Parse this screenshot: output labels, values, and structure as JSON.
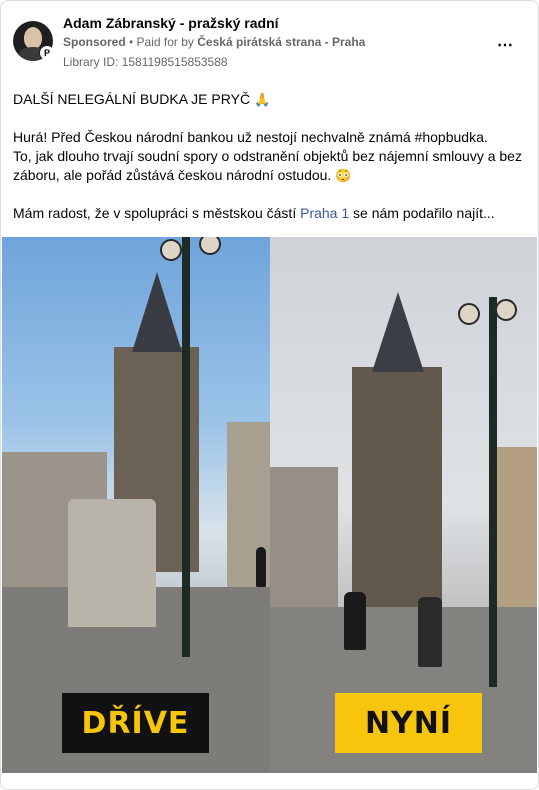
{
  "post": {
    "author": "Adam Zábranský - pražský radní",
    "sponsored": "Sponsored",
    "paid_prefix": " • Paid for by ",
    "payer": "Česká pirátská strana - Praha",
    "library_id": "Library ID: 1581198515853588",
    "more_icon": "⋯"
  },
  "content": {
    "headline": "DALŠÍ NELEGÁLNÍ BUDKA JE PRYČ",
    "headline_emoji": "🙏",
    "para1_line1": "Hurá! Před Českou národní bankou už nestojí nechvalně známá #hopbudka.",
    "para1_line2": "To, jak dlouho trvají soudní spory o odstranění objektů bez nájemní smlouvy a bez záboru, ale pořád zůstává českou národní ostudou.",
    "para1_emoji": "😳",
    "para2_prefix": "Mám radost, že v spolupráci s městskou částí ",
    "para2_link": "Praha 1",
    "para2_suffix": " se nám podařilo najít..."
  },
  "image": {
    "label_before": "DŘÍVE",
    "label_now": "NYNÍ",
    "accent_yellow": "#f7c50c",
    "accent_black": "#111111"
  },
  "colors": {
    "link": "#385898",
    "meta": "#65676b"
  }
}
